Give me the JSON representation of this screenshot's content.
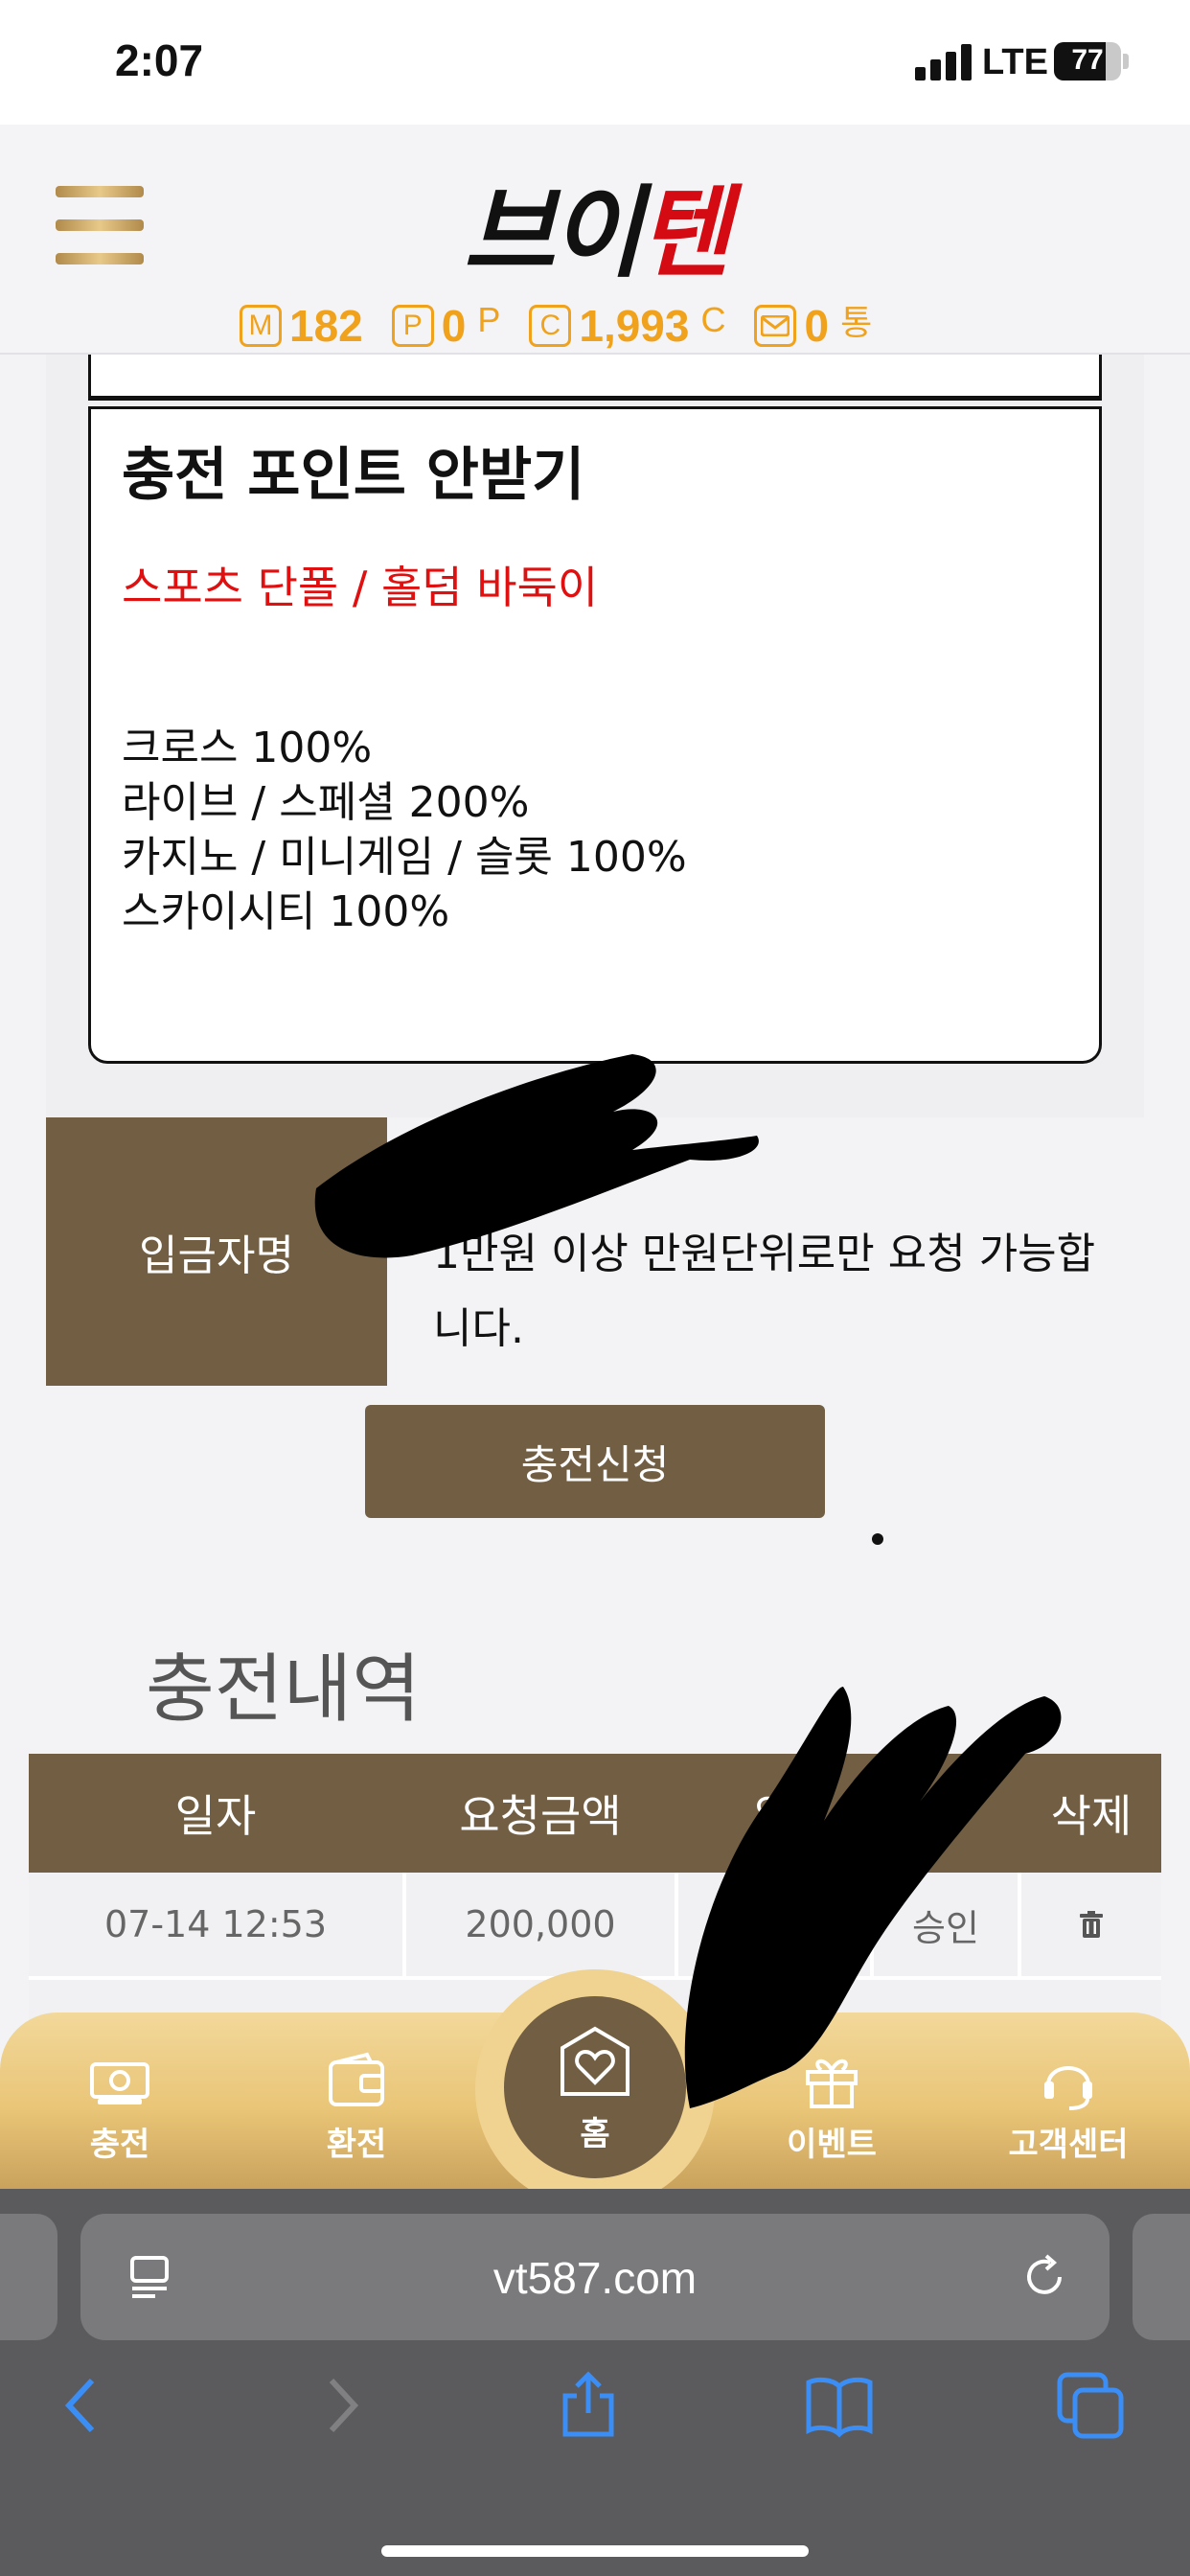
{
  "status_bar": {
    "time": "2:07",
    "network": "LTE",
    "battery": "77",
    "battery_level": 0.77
  },
  "header": {
    "logo_part1": "브이",
    "logo_part2": "텐",
    "wallet": [
      {
        "icon": "M",
        "value": "182",
        "unit": ""
      },
      {
        "icon": "P",
        "value": "0",
        "unit": "P"
      },
      {
        "icon": "C",
        "value": "1,993",
        "unit": "C"
      },
      {
        "icon": "mail-icon",
        "value": "0",
        "unit": "통"
      }
    ]
  },
  "promo": {
    "title": "충전 포인트 안받기",
    "subtitle": "스포츠 단폴 / 홀덤 바둑이",
    "lines": [
      "크로스 100%",
      "라이브 / 스페셜 200%",
      "카지노 / 미니게임 / 슬롯 100%",
      "스카이시티 100%"
    ]
  },
  "deposit": {
    "label": "입금자명",
    "note": "1만원 이상 만원단위로만 요청 가능합니다."
  },
  "charge_button": "충전신청",
  "history": {
    "title": "충전내역",
    "columns": [
      "일자",
      "요청금액",
      "입",
      "",
      "삭제"
    ],
    "rows": [
      {
        "date": "07-14 12:53",
        "amount": "200,000",
        "status": "승인"
      }
    ]
  },
  "bottom_nav": {
    "charge": "충전",
    "exchange": "환전",
    "home": "홈",
    "event": "이벤트",
    "support": "고객센터"
  },
  "browser": {
    "url": "vt587.com"
  },
  "colors": {
    "brown": "#725f43",
    "gold": "#e9c577",
    "accent_red": "#e01010",
    "wallet_orange": "#f0a21c"
  }
}
